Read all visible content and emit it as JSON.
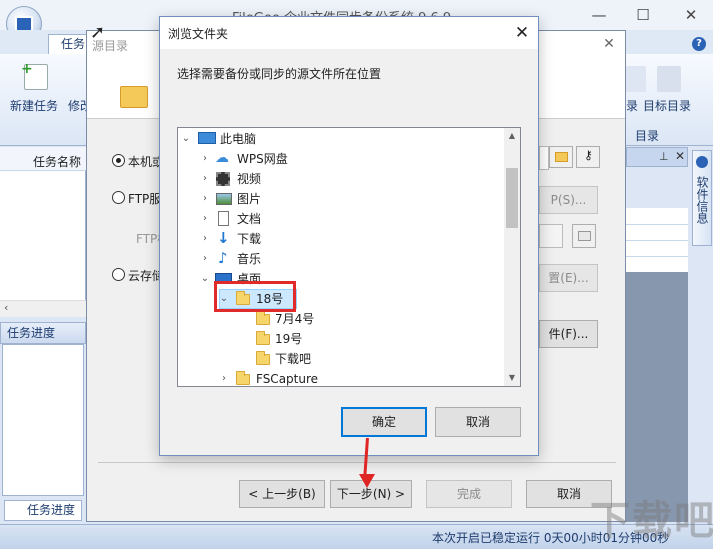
{
  "app": {
    "title": "FileGee 企业文件同步备份系统 9.6.9",
    "ribbon_tab": "任务",
    "ribbon_left": [
      "新建任务",
      "修改"
    ],
    "ribbon_right": [
      "录",
      "目标目录"
    ],
    "ribbon_group": "目录",
    "left_column_header": "任务名称",
    "progress_title": "任务进度",
    "progress_tab": "任务进度",
    "side_tab": "软件信息",
    "status": "本次开启已稳定运行 0天00小时01分钟00秒",
    "watermark": "下载吧",
    "help": "?"
  },
  "wizard": {
    "title": "源目录",
    "options": [
      {
        "label": "本机或",
        "selected": true
      },
      {
        "label": "FTP服",
        "selected": false
      },
      {
        "label": "云存储",
        "selected": false
      }
    ],
    "ftp_hint": "FTP标",
    "side_buttons": [
      "P(S)...",
      "置(E)...",
      "件(F)..."
    ],
    "nav": {
      "prev": "< 上一步(B)",
      "next": "下一步(N) >",
      "finish": "完成",
      "cancel": "取消"
    }
  },
  "browse": {
    "title": "浏览文件夹",
    "description": "选择需要备份或同步的源文件所在位置",
    "tree": [
      {
        "label": "此电脑",
        "icon": "computer-icon",
        "expander": "expanded"
      },
      {
        "label": "WPS网盘",
        "icon": "cloud-icon",
        "expander": "collapsed"
      },
      {
        "label": "视频",
        "icon": "video-icon",
        "expander": "collapsed"
      },
      {
        "label": "图片",
        "icon": "picture-icon",
        "expander": "collapsed"
      },
      {
        "label": "文档",
        "icon": "document-icon",
        "expander": "collapsed"
      },
      {
        "label": "下载",
        "icon": "download-icon",
        "expander": "collapsed"
      },
      {
        "label": "音乐",
        "icon": "music-icon",
        "expander": "collapsed"
      },
      {
        "label": "桌面",
        "icon": "desktop-icon",
        "expander": "expanded"
      },
      {
        "label": "18号",
        "icon": "folder-icon",
        "expander": "expanded",
        "selected": true
      },
      {
        "label": "7月4号",
        "icon": "folder-icon",
        "expander": "none"
      },
      {
        "label": "19号",
        "icon": "folder-icon",
        "expander": "none"
      },
      {
        "label": "下载吧",
        "icon": "folder-icon",
        "expander": "none"
      },
      {
        "label": "FSCapture",
        "icon": "folder-icon",
        "expander": "collapsed"
      }
    ],
    "ok": "确定",
    "cancel": "取消"
  },
  "colors": {
    "accent": "#0078d7",
    "annotation_red": "#e12b2b",
    "selection": "#cce8ff"
  }
}
